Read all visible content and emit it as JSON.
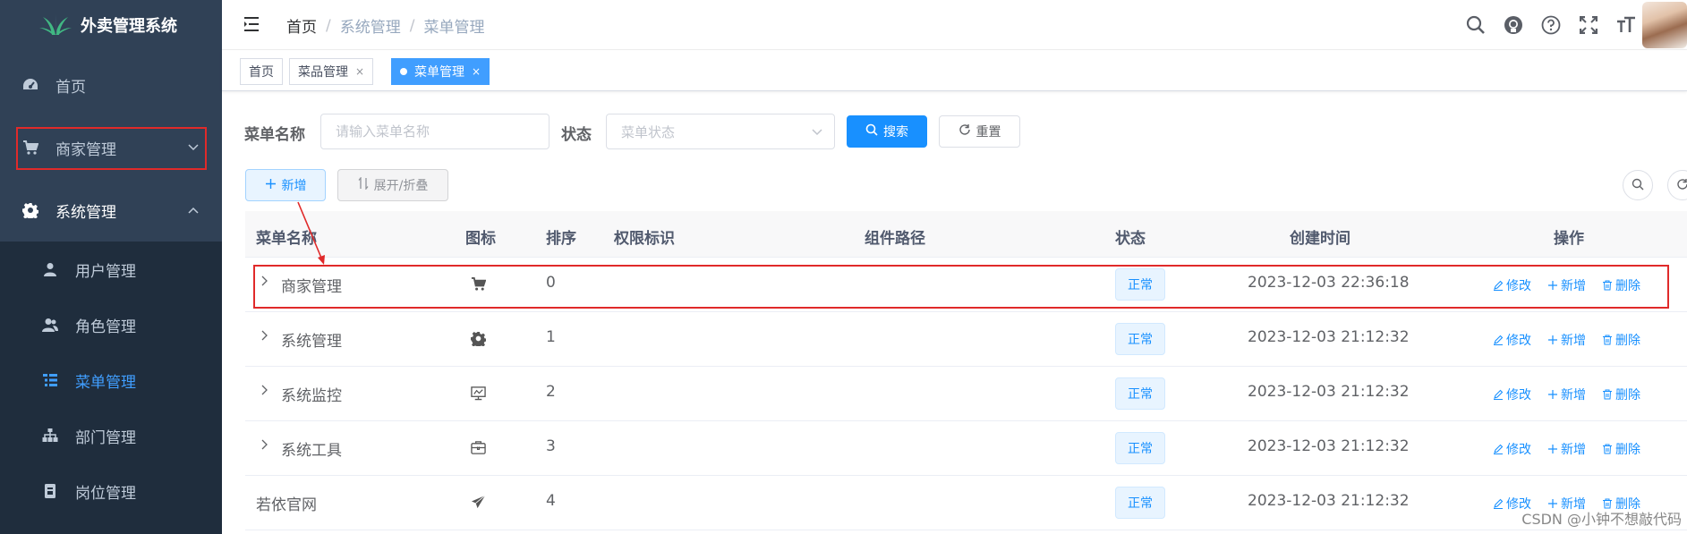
{
  "sidebar": {
    "app_title": "外卖管理系统",
    "items": [
      {
        "label": "首页",
        "icon": "dashboard-icon"
      },
      {
        "label": "商家管理",
        "icon": "cart-icon"
      },
      {
        "label": "系统管理",
        "icon": "gear-icon"
      }
    ],
    "subitems": [
      {
        "label": "用户管理",
        "icon": "user-icon"
      },
      {
        "label": "角色管理",
        "icon": "peoples-icon"
      },
      {
        "label": "菜单管理",
        "icon": "tree-table-icon"
      },
      {
        "label": "部门管理",
        "icon": "tree-icon"
      },
      {
        "label": "岗位管理",
        "icon": "post-icon"
      }
    ],
    "active_color": "#409eff"
  },
  "header": {
    "breadcrumb": [
      "首页",
      "系统管理",
      "菜单管理"
    ],
    "separator": "/"
  },
  "tags": [
    {
      "label": "首页"
    },
    {
      "label": "菜品管理",
      "close": "×"
    },
    {
      "label": "菜单管理",
      "close": "×"
    }
  ],
  "search": {
    "name_label": "菜单名称",
    "name_placeholder": "请输入菜单名称",
    "status_label": "状态",
    "status_placeholder": "菜单状态",
    "search_button": "搜索",
    "reset_button": "重置"
  },
  "toolbar": {
    "add_button": "新增",
    "expand_button": "展开/折叠"
  },
  "table": {
    "headers": [
      "菜单名称",
      "图标",
      "排序",
      "权限标识",
      "组件路径",
      "状态",
      "创建时间",
      "操作"
    ],
    "rows": [
      {
        "name": "商家管理",
        "icon": "cart-icon",
        "order": "0",
        "status": "正常",
        "created": "2023-12-03 22:36:18",
        "expandable": true
      },
      {
        "name": "系统管理",
        "icon": "gear-icon",
        "order": "1",
        "status": "正常",
        "created": "2023-12-03 21:12:32",
        "expandable": true
      },
      {
        "name": "系统监控",
        "icon": "monitor-icon",
        "order": "2",
        "status": "正常",
        "created": "2023-12-03 21:12:32",
        "expandable": true
      },
      {
        "name": "系统工具",
        "icon": "toolbox-icon",
        "order": "3",
        "status": "正常",
        "created": "2023-12-03 21:12:32",
        "expandable": true
      },
      {
        "name": "若依官网",
        "icon": "send-icon",
        "order": "4",
        "status": "正常",
        "created": "2023-12-03 21:12:32",
        "expandable": false
      }
    ],
    "actions": {
      "edit": "修改",
      "add": "新增",
      "delete": "删除"
    }
  },
  "watermark": "CSDN @小钟不想敲代码",
  "colors": {
    "primary": "#1890ff",
    "sidebar_bg": "#304156",
    "submenu_bg": "#1f2d3d",
    "highlight_red": "#e02a2a"
  }
}
